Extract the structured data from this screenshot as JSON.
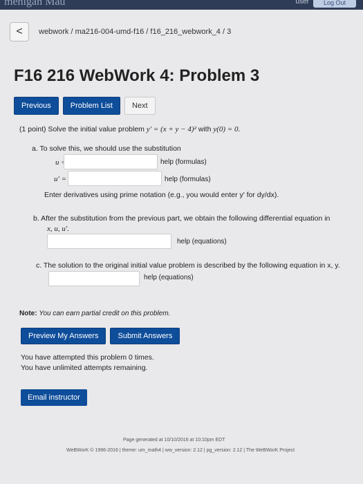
{
  "topbar": {
    "partial_text": "menigan Mau",
    "user_text": "user",
    "logout_label": "Log Out"
  },
  "breadcrumb": {
    "back_symbol": "<",
    "path": "webwork / ma216-004-umd-f16 / f16_216_webwork_4 / 3"
  },
  "page": {
    "title": "F16 216 WebWork 4: Problem 3"
  },
  "nav": {
    "previous": "Previous",
    "problem_list": "Problem List",
    "next": "Next"
  },
  "problem": {
    "intro_prefix": "(1 point) Solve the initial value problem",
    "intro_eq": "y′ = (x + y − 4)²",
    "intro_with": "with",
    "intro_ic": "y(0) = 0.",
    "part_a": "a. To solve this, we should use the substitution",
    "u_label": "u =",
    "u_prime_label": "u′ =",
    "help_formulas": "help (formulas)",
    "derivative_note": "Enter derivatives using prime notation (e.g., you would enter y′ for dy/dx).",
    "part_b_line1": "b. After the substitution from the previous part, we obtain the following differential equation in",
    "part_b_vars": "x, u, u′.",
    "help_equations": "help (equations)",
    "part_c": "c. The solution to the original initial value problem is described by the following equation in x, y."
  },
  "note": {
    "label": "Note:",
    "text": "You can earn partial credit on this problem."
  },
  "submit": {
    "preview": "Preview My Answers",
    "submit": "Submit Answers"
  },
  "attempts": {
    "line1": "You have attempted this problem 0 times.",
    "line2": "You have unlimited attempts remaining."
  },
  "email": {
    "label": "Email instructor"
  },
  "footer": {
    "generated": "Page generated at 10/10/2016 at 10:10pm EDT",
    "copyright": "WeBWorK © 1996-2016 | theme: um_math4 | ww_version: 2.12 | pg_version: 2.12 | The WeBWorK Project"
  }
}
